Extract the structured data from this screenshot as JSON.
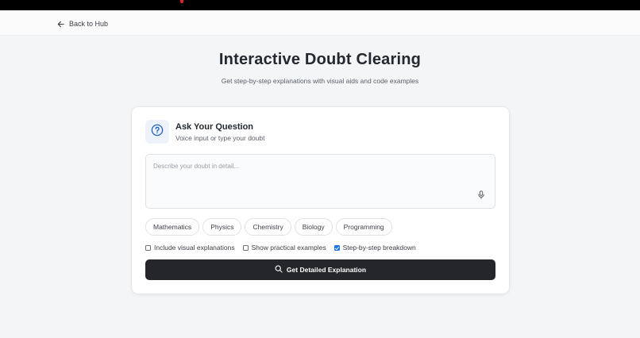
{
  "nav": {
    "back_label": "Back to Hub"
  },
  "header": {
    "title": "Interactive Doubt Clearing",
    "subtitle": "Get step-by-step explanations with visual aids and code examples"
  },
  "question_card": {
    "title": "Ask Your Question",
    "subtitle": "Voice input or type your doubt",
    "input": {
      "placeholder": "Describe your doubt in detail...",
      "value": ""
    },
    "subjects": [
      "Mathematics",
      "Physics",
      "Chemistry",
      "Biology",
      "Programming"
    ],
    "options": [
      {
        "label": "Include visual explanations",
        "checked": false
      },
      {
        "label": "Show practical examples",
        "checked": false
      },
      {
        "label": "Step-by-step breakdown",
        "checked": true
      }
    ],
    "submit_label": "Get Detailed Explanation"
  },
  "colors": {
    "accent": "#1a73e8",
    "button_bg": "#24262a",
    "page_bg": "#f3f5f7"
  },
  "icons": {
    "back": "arrow-left-icon",
    "question": "question-circle-icon",
    "mic": "microphone-icon",
    "search": "search-icon"
  }
}
